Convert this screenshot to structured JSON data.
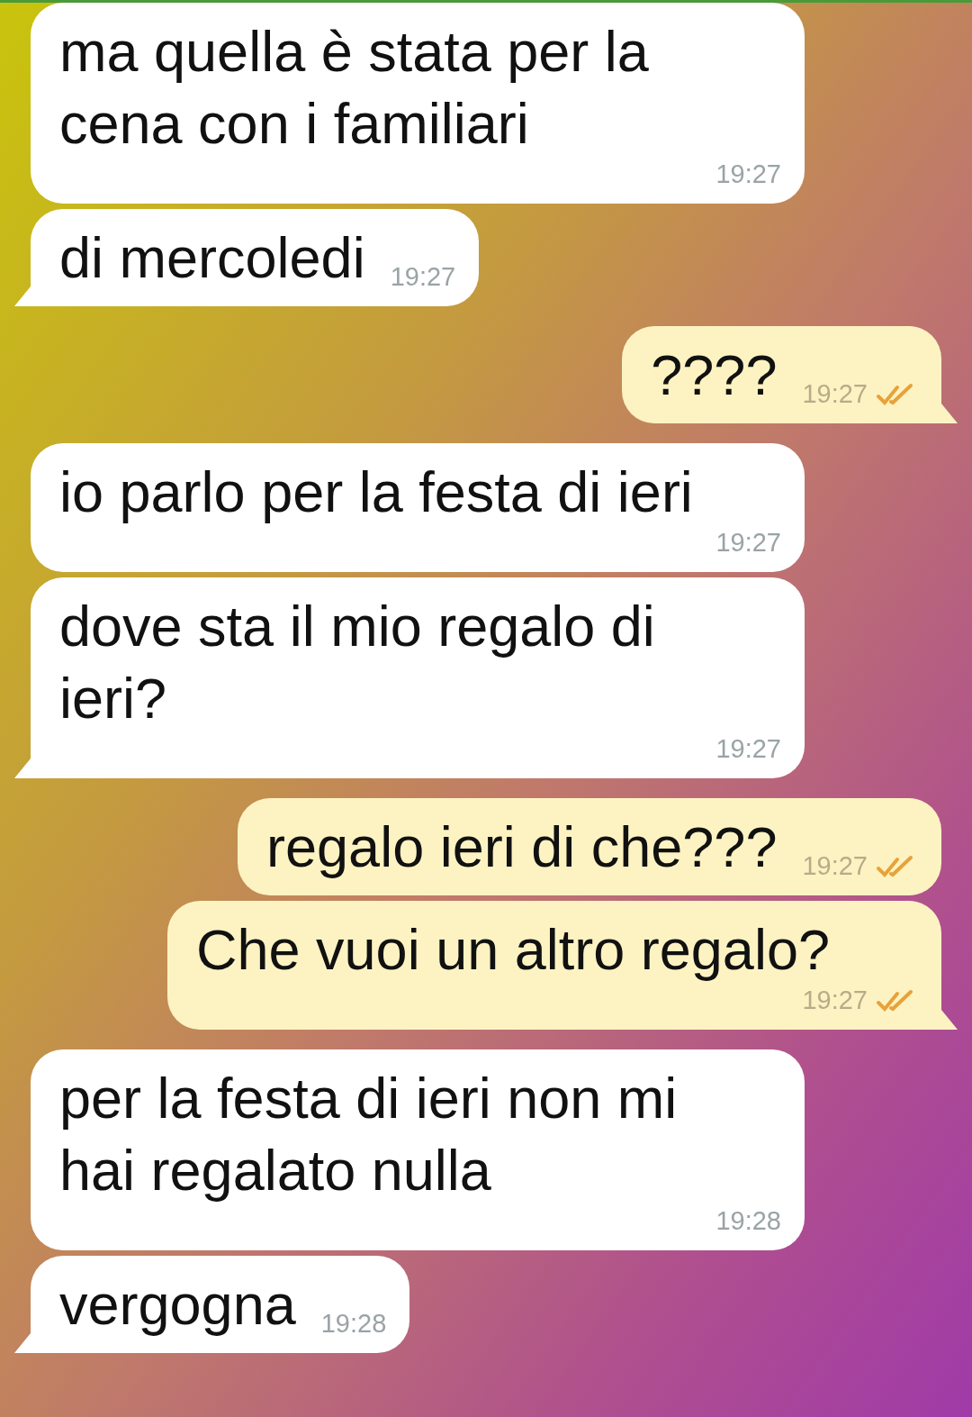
{
  "messages": [
    {
      "kind": "incoming",
      "text": "ma quella è stata per la cena con i familiari",
      "time": "19:27",
      "tail": false
    },
    {
      "kind": "incoming",
      "text": "di mercoledi",
      "time": "19:27",
      "tail": true
    },
    {
      "kind": "outgoing",
      "text": "????",
      "time": "19:27",
      "tail": true,
      "read": true
    },
    {
      "kind": "incoming",
      "text": "io parlo per la festa di ieri",
      "time": "19:27",
      "tail": false
    },
    {
      "kind": "incoming",
      "text": "dove sta il mio regalo di ieri?",
      "time": "19:27",
      "tail": true
    },
    {
      "kind": "outgoing",
      "text": "regalo ieri di che???",
      "time": "19:27",
      "tail": false,
      "read": true
    },
    {
      "kind": "outgoing",
      "text": "Che vuoi un altro regalo?",
      "time": "19:27",
      "tail": true,
      "read": true
    },
    {
      "kind": "incoming",
      "text": "per la festa di ieri non mi hai regalato nulla",
      "time": "19:28",
      "tail": false
    },
    {
      "kind": "incoming",
      "text": "vergogna",
      "time": "19:28",
      "tail": true
    }
  ]
}
